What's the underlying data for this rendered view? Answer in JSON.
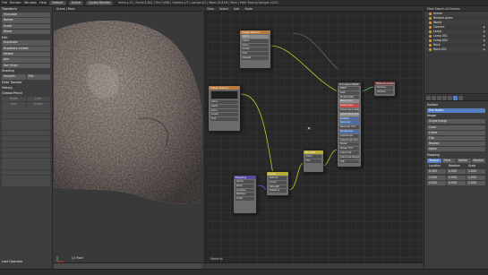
{
  "topbar": {
    "menus": [
      "File",
      "Render",
      "Window",
      "Help"
    ],
    "layout": "Default",
    "scene": "Scene",
    "engine": "Cycles Render",
    "stats": "Verts:4,12 | Faces:3,842 | Tris:7,638 | Objects:1/7 | Lamps:0/2 | Mem:15.61M | Rock | Path Tracing Sample 10/10"
  },
  "toolshelf": {
    "sections": [
      {
        "title": "Transform",
        "items": [
          "Translate",
          "Rotate",
          "Scale",
          "Mirror"
        ]
      },
      {
        "title": "Edit",
        "items": [
          "Duplicate",
          "Duplicate Linked",
          "Delete",
          "Join"
        ]
      },
      {
        "title": "Set Origin",
        "items": []
      },
      {
        "title": "Shading",
        "items": [
          "Smooth",
          "Flat"
        ]
      },
      {
        "title": "Data Transfer",
        "items": []
      },
      {
        "title": "History",
        "items": []
      },
      {
        "title": "Grease Pencil",
        "items": [
          "Draw",
          "Line",
          "Poly",
          "Erase"
        ]
      }
    ],
    "last_op": "Last Operator"
  },
  "viewport": {
    "header": "Scene | Rock",
    "footer_label": "(1) Rock"
  },
  "node_editor": {
    "menus": [
      "View",
      "Select",
      "Add",
      "Node"
    ],
    "material_name": "Material",
    "nodes": [
      {
        "id": "tex-coord",
        "title": "Image Texture",
        "fields": [
          "Color",
          "Alpha",
          "Color",
          "Linear",
          "Flat",
          "Repeat"
        ]
      },
      {
        "id": "image-tex",
        "title": "Image Texture",
        "fields": [
          "Color",
          "Alpha",
          "Color",
          "Linear",
          "Flat"
        ]
      },
      {
        "id": "bump",
        "title": "Bump",
        "fields": [
          "Normal",
          "Invert",
          "Strength",
          "Distance"
        ]
      },
      {
        "id": "mapping",
        "title": "Mapping",
        "fields": [
          "Vector",
          "Point",
          "Location",
          "Rotation",
          "Scale"
        ]
      },
      {
        "id": "mix",
        "title": "MixRGB",
        "fields": [
          "Color",
          "Fac"
        ]
      },
      {
        "id": "principled",
        "title": "Principled BSDF",
        "fields": [
          "BSDF",
          "GGX",
          "Multiscatter",
          "Base Color",
          "Subsurface",
          "Subsurface Radius",
          "Subsurface Color",
          "Metallic",
          "Specular",
          "Specular Tint",
          "Roughness",
          "Anisotropic",
          "Anisotropic Rot",
          "Sheen",
          "Sheen Tint",
          "Clearcoat",
          "Clearcoat Rough",
          "IOR",
          "Transmission",
          "Normal",
          "Clearcoat Normal",
          "Tangent"
        ]
      },
      {
        "id": "output",
        "title": "Material Output",
        "fields": [
          "Surface",
          "Volume",
          "Displacement"
        ]
      }
    ]
  },
  "outliner": {
    "header": "View  Search  All Scenes",
    "rows": [
      "Scene",
      "RenderLayers",
      "World",
      "Camera",
      "Lamp",
      "Lamp.001",
      "Lamp.002",
      "Rock",
      "Rock.001"
    ]
  },
  "properties": {
    "sections": [
      {
        "title": "Surface",
        "fields": [
          "Use Nodes"
        ]
      },
      {
        "title": "Image",
        "fields": [
          "Single Image",
          "Color",
          "Linear",
          "Flat",
          "Repeat",
          "Alpha"
        ]
      },
      {
        "title": "Mapping",
        "fields": [
          "Texture",
          "Point",
          "Vector",
          "Normal"
        ]
      }
    ],
    "location_label": "Location",
    "rotation_label": "Rotation",
    "scale_label": "Scale",
    "values": [
      "0.000",
      "0.000",
      "0.000",
      "1.000",
      "1.000",
      "1.000"
    ]
  },
  "colors": {
    "accent": "#5680c2",
    "texture_header": "#b87a3c",
    "output_header": "#6d3a3a",
    "color_socket": "#c7c729",
    "rock_base": "#8a7e7a"
  }
}
